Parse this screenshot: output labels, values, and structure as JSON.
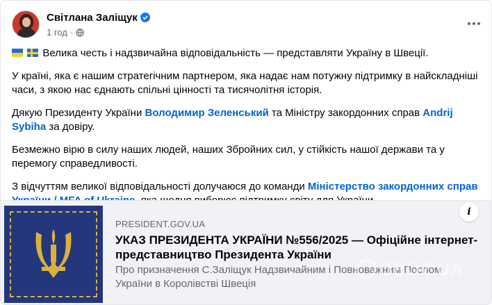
{
  "post": {
    "author": "Світлана Заліщук",
    "time": "1 год",
    "dot": "·",
    "icons": {
      "verified": "verified-badge-icon",
      "privacy": "globe-icon",
      "more": "more-options-icon"
    },
    "paragraphs": {
      "p1": "Велика честь і надзвичайна відповідальність — представляти Україну в Швеції.",
      "p2": "У країні, яка є нашим стратегічним партнером, яка надає нам потужну підтримку в найскладніші часи, з якою нас єднають спільні цінності та тисячолітня історія.",
      "p3_before": "Дякую Президенту України ",
      "p3_mention1": "Володимир Зеленський",
      "p3_middle": " та Міністру закордонних справ ",
      "p3_mention2": "Andrij Sybiha",
      "p3_after": " за довіру.",
      "p4": "Безмежно вірю в силу наших людей, наших Збройних сил, у стійкість нашої держави та у перемогу справедливості.",
      "p5_before": "З відчуттям великої відповідальності долучаюся до команди ",
      "p5_mention": "Міністерство закордонних справ України / MFA of Ukraine",
      "p5_after": ", яка щодня виборює підтримку світу для України."
    }
  },
  "link_card": {
    "domain": "PRESIDENT.GOV.UA",
    "title": "УКАЗ ПРЕЗИДЕНТА УКРАЇНИ №556/2025 — Офіційне інтернет-представництво Президента України",
    "description": "Про призначення С.Заліщук Надзвичайним і Повноважним Послом України в Королівстві Швеція",
    "info_label": "i",
    "image_icon": "trident-emblem-icon"
  },
  "watermark": "OBOZ.UA",
  "colors": {
    "link": "#0064d1",
    "verified": "#1877f2",
    "emblem_bg": "#24367c",
    "emblem_gold": "#d9b23a"
  }
}
